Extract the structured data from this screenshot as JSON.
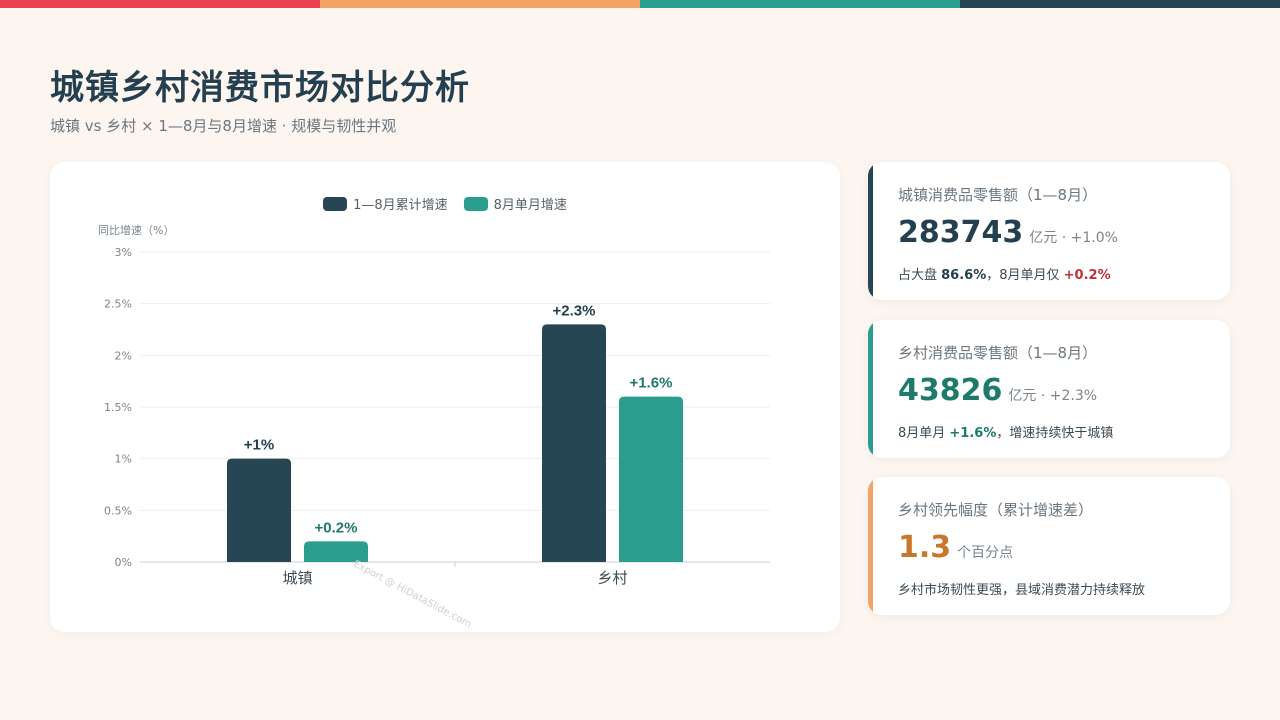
{
  "colors": {
    "topbar": [
      "#e8434f",
      "#f2a366",
      "#2a9d8f",
      "#264653"
    ],
    "series1": "#264653",
    "series2": "#2a9d8f",
    "accent_orange": "#f2a366",
    "value_orange": "#c8782d",
    "highlight_red": "#c0303a",
    "highlight_green": "#1f7a6e"
  },
  "header": {
    "title": "城镇乡村消费市场对比分析",
    "subtitle": "城镇 vs 乡村 × 1—8月与8月增速 · 规模与韧性并观"
  },
  "chart_data": {
    "type": "bar",
    "categories": [
      "城镇",
      "乡村"
    ],
    "series": [
      {
        "name": "1—8月累计增速",
        "values": [
          1.0,
          2.3
        ],
        "labels": [
          "+1%",
          "+2.3%"
        ]
      },
      {
        "name": "8月单月增速",
        "values": [
          0.2,
          1.6
        ],
        "labels": [
          "+0.2%",
          "+1.6%"
        ]
      }
    ],
    "ylabel": "同比增速（%）",
    "ylim": [
      0,
      3
    ],
    "yticks": [
      "0%",
      "0.5%",
      "1%",
      "1.5%",
      "2%",
      "2.5%",
      "3%"
    ],
    "grid": true,
    "legend": "top-center"
  },
  "watermark": "Export @ HiDataSlide.com",
  "cards": [
    {
      "label": "城镇消费品零售额（1—8月）",
      "value": "283743",
      "unit": "亿元 · +1.0%",
      "note_pre": "占大盘 ",
      "note_b1": "86.6%",
      "note_mid": "，8月单月仅 ",
      "note_b2": "+0.2%",
      "note_post": ""
    },
    {
      "label": "乡村消费品零售额（1—8月）",
      "value": "43826",
      "unit": "亿元 · +2.3%",
      "note_pre": "8月单月 ",
      "note_b1": "+1.6%",
      "note_post": "，增速持续快于城镇"
    },
    {
      "label": "乡村领先幅度（累计增速差）",
      "value": "1.3",
      "unit": "个百分点",
      "note": "乡村市场韧性更强，县域消费潜力持续释放"
    }
  ]
}
